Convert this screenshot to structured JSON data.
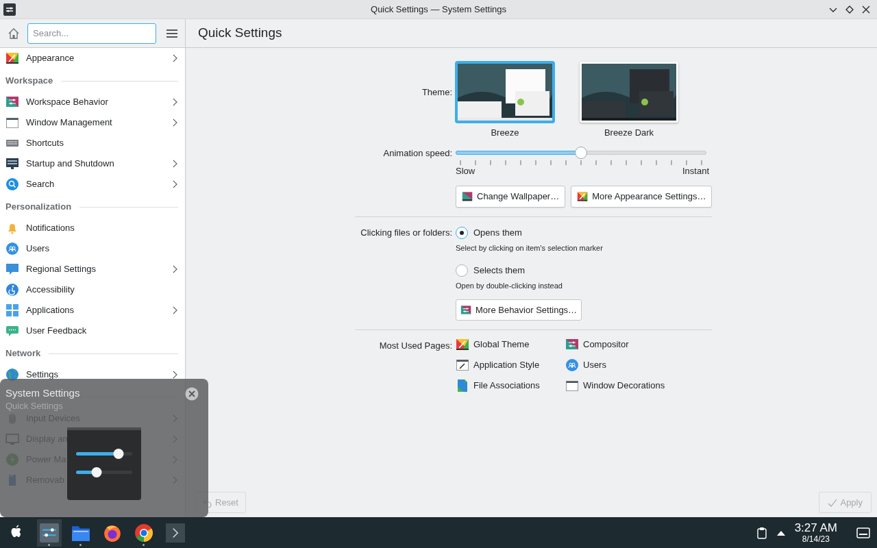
{
  "window": {
    "title": "Quick Settings — System Settings"
  },
  "sidebar": {
    "search": {
      "placeholder": "Search..."
    },
    "items": [
      {
        "kind": "item",
        "label": "Appearance",
        "has_children": true
      },
      {
        "kind": "heading",
        "label": "Workspace"
      },
      {
        "kind": "item",
        "label": "Workspace Behavior",
        "has_children": true
      },
      {
        "kind": "item",
        "label": "Window Management",
        "has_children": true
      },
      {
        "kind": "item",
        "label": "Shortcuts",
        "has_children": false
      },
      {
        "kind": "item",
        "label": "Startup and Shutdown",
        "has_children": true
      },
      {
        "kind": "item",
        "label": "Search",
        "has_children": true
      },
      {
        "kind": "heading",
        "label": "Personalization"
      },
      {
        "kind": "item",
        "label": "Notifications",
        "has_children": false
      },
      {
        "kind": "item",
        "label": "Users",
        "has_children": false
      },
      {
        "kind": "item",
        "label": "Regional Settings",
        "has_children": true
      },
      {
        "kind": "item",
        "label": "Accessibility",
        "has_children": false
      },
      {
        "kind": "item",
        "label": "Applications",
        "has_children": true
      },
      {
        "kind": "item",
        "label": "User Feedback",
        "has_children": false
      },
      {
        "kind": "heading",
        "label": "Network"
      },
      {
        "kind": "item",
        "label": "Settings",
        "has_children": true
      },
      {
        "kind": "divider"
      },
      {
        "kind": "item",
        "label": "Input Devices",
        "has_children": true
      },
      {
        "kind": "item",
        "label": "Display an",
        "has_children": true
      },
      {
        "kind": "item",
        "label": "Power Ma",
        "has_children": true
      },
      {
        "kind": "item",
        "label": "Removab",
        "has_children": true
      }
    ]
  },
  "page": {
    "title": "Quick Settings",
    "theme": {
      "label": "Theme:",
      "options": [
        {
          "name": "Breeze",
          "selected": true
        },
        {
          "name": "Breeze Dark",
          "selected": false
        }
      ]
    },
    "animation": {
      "label": "Animation speed:",
      "level": 0.5,
      "min_label": "Slow",
      "max_label": "Instant"
    },
    "appearance_buttons": [
      "Change Wallpaper…",
      "More Appearance Settings…"
    ],
    "clicking": {
      "label": "Clicking files or folders:",
      "options": [
        {
          "label": "Opens them",
          "description": "Select by clicking on item's selection marker",
          "selected": true
        },
        {
          "label": "Selects them",
          "description": "Open by double-clicking instead",
          "selected": false
        }
      ],
      "button": "More Behavior Settings…"
    },
    "most_used": {
      "label": "Most Used Pages:",
      "pages": [
        "Global Theme",
        "Compositor",
        "Application Style",
        "Users",
        "File Associations",
        "Window Decorations"
      ]
    },
    "footer": {
      "reset": {
        "label": "Reset",
        "disabled": true
      },
      "apply": {
        "label": "Apply",
        "disabled": true
      }
    }
  },
  "tooltip": {
    "title": "System Settings",
    "subtitle": "Quick Settings"
  },
  "taskbar": {
    "apps": [
      {
        "running": false
      },
      {
        "running": true
      },
      {
        "running": true
      },
      {
        "running": false
      },
      {
        "running": true
      },
      {
        "running": false
      }
    ],
    "clock": {
      "time": "3:27 AM",
      "date": "8/14/23"
    }
  }
}
